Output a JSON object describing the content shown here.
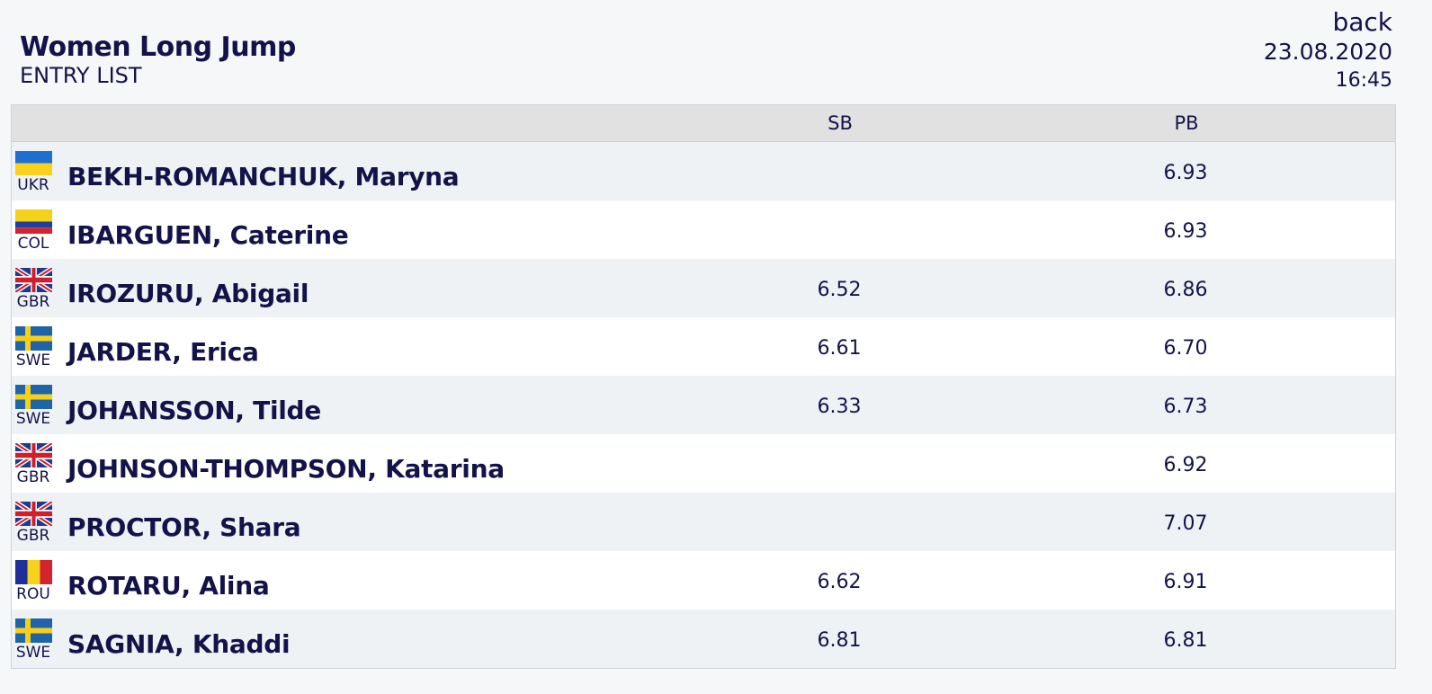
{
  "header": {
    "title": "Women Long Jump",
    "subtitle": "ENTRY LIST",
    "back_label": "back",
    "date": "23.08.2020",
    "time": "16:45"
  },
  "table": {
    "columns": {
      "athlete": "",
      "sb": "SB",
      "pb": "PB"
    },
    "rows": [
      {
        "country": "UKR",
        "flag_icon": "ukraine-flag-icon",
        "name": "BEKH-ROMANCHUK, Maryna",
        "sb": "",
        "pb": "6.93"
      },
      {
        "country": "COL",
        "flag_icon": "colombia-flag-icon",
        "name": "IBARGUEN, Caterine",
        "sb": "",
        "pb": "6.93"
      },
      {
        "country": "GBR",
        "flag_icon": "great-britain-flag-icon",
        "name": "IROZURU, Abigail",
        "sb": "6.52",
        "pb": "6.86"
      },
      {
        "country": "SWE",
        "flag_icon": "sweden-flag-icon",
        "name": "JARDER, Erica",
        "sb": "6.61",
        "pb": "6.70"
      },
      {
        "country": "SWE",
        "flag_icon": "sweden-flag-icon",
        "name": "JOHANSSON, Tilde",
        "sb": "6.33",
        "pb": "6.73"
      },
      {
        "country": "GBR",
        "flag_icon": "great-britain-flag-icon",
        "name": "JOHNSON-THOMPSON, Katarina",
        "sb": "",
        "pb": "6.92"
      },
      {
        "country": "GBR",
        "flag_icon": "great-britain-flag-icon",
        "name": "PROCTOR, Shara",
        "sb": "",
        "pb": "7.07"
      },
      {
        "country": "ROU",
        "flag_icon": "romania-flag-icon",
        "name": "ROTARU, Alina",
        "sb": "6.62",
        "pb": "6.91"
      },
      {
        "country": "SWE",
        "flag_icon": "sweden-flag-icon",
        "name": "SAGNIA, Khaddi",
        "sb": "6.81",
        "pb": "6.81"
      }
    ]
  },
  "colors": {
    "text": "#13134a",
    "header_bg": "#e1e1e1",
    "row_alt_bg": "#eef2f5",
    "page_bg": "#f5f7f9"
  }
}
